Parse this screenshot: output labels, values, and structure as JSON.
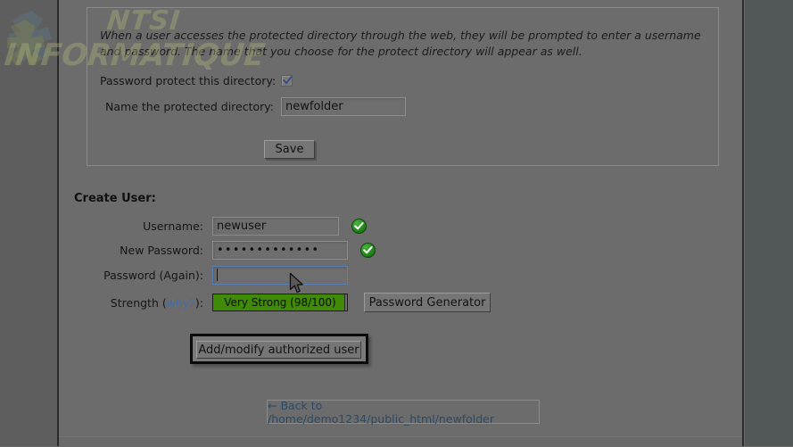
{
  "watermark": {
    "line1": "NTSI",
    "line2": "INFORMATIQUE"
  },
  "protect_panel": {
    "note": "When a user accesses the protected directory through the web, they will be prompted to enter a username and password. The name that you choose for the protect directory will appear as well.",
    "checkbox_label": "Password protect this directory:",
    "checkbox_checked": "checked",
    "dirname_label": "Name the protected directory:",
    "dirname_value": "newfolder",
    "save_label": "Save"
  },
  "create_user": {
    "title": "Create User:",
    "username_label": "Username:",
    "username_value": "newuser",
    "username_status": "valid",
    "password_label": "New Password:",
    "password_value": "•••••••••••••",
    "password_status": "valid",
    "password_again_label": "Password (Again):",
    "password_again_value": "",
    "strength_label_prefix": "Strength (",
    "strength_label_link": "why?",
    "strength_label_suffix": "):",
    "strength_text": "Very Strong (98/100)",
    "strength_percent": 98,
    "generator_label": "Password Generator",
    "submit_label": "Add/modify authorized user"
  },
  "footer": {
    "back_link": "← Back to /home/demo1234/public_html/newfolder"
  },
  "colors": {
    "page_background": "#6c6c6c",
    "strength_fill": "#3f8a06",
    "link": "#3f6fa8",
    "ok_badge": "#1f7c16",
    "focus_border": "#5a7fb5"
  }
}
